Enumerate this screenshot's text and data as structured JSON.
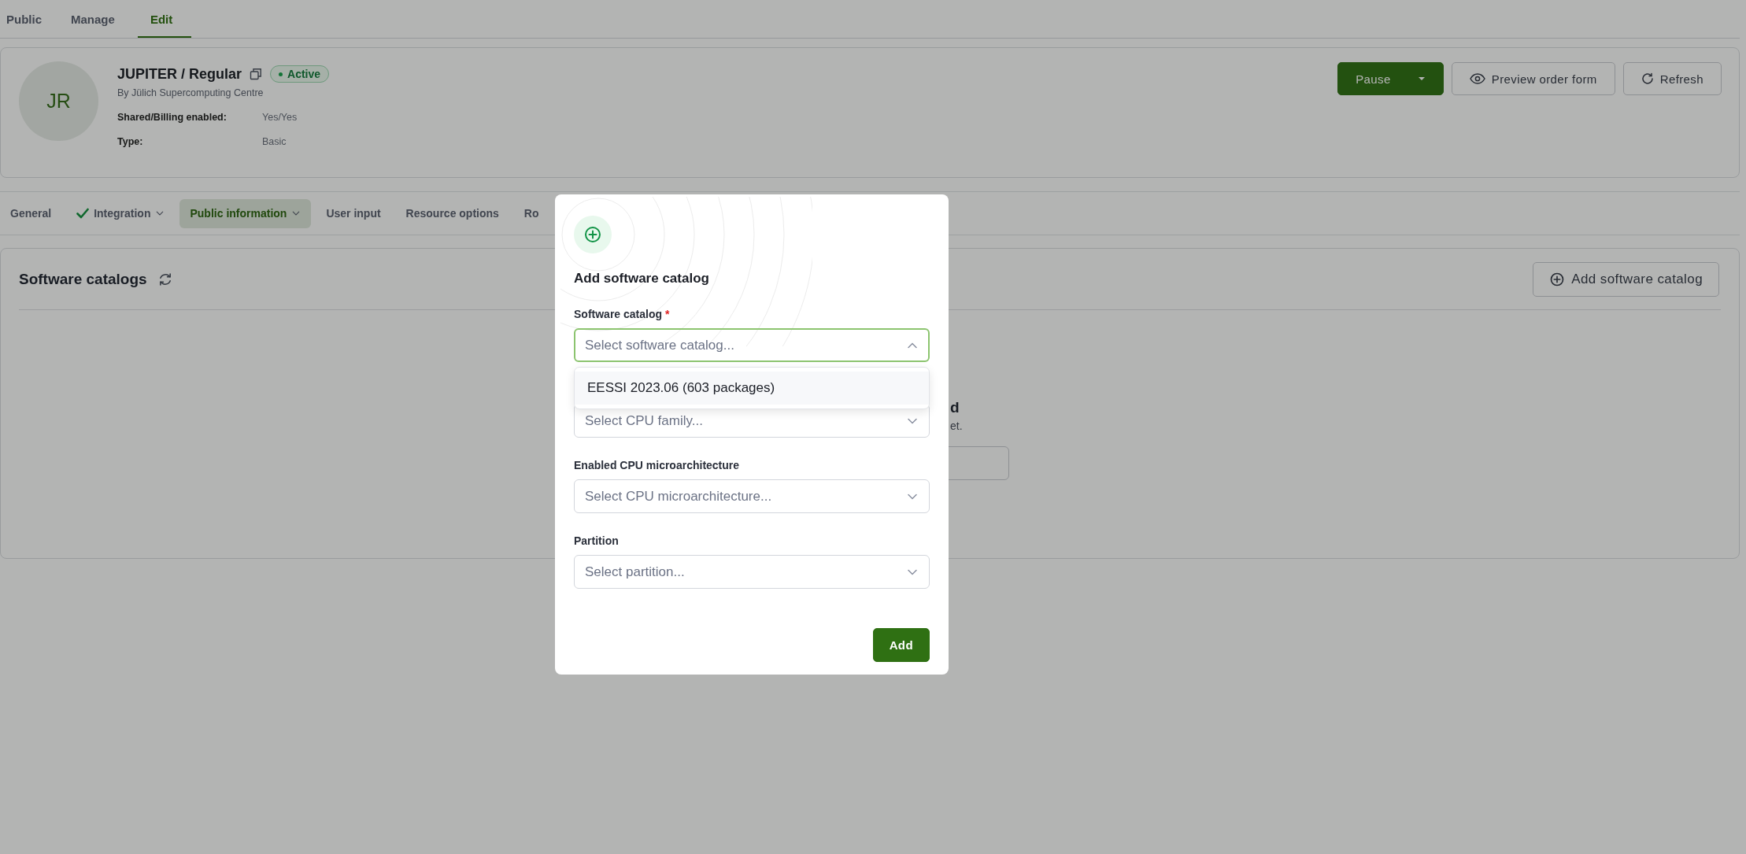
{
  "top_tabs": [
    {
      "label": "Public",
      "selected": false
    },
    {
      "label": "Manage",
      "selected": false
    },
    {
      "label": "Edit",
      "selected": true
    }
  ],
  "resource": {
    "initials": "JR",
    "title": "JUPITER / Regular",
    "status": "Active",
    "provider": "By Jülich Supercomputing Centre",
    "details": [
      {
        "label": "Shared/Billing enabled:",
        "value": "Yes/Yes"
      },
      {
        "label": "Type:",
        "value": "Basic"
      }
    ]
  },
  "actions": [
    {
      "kind": "split",
      "label": "Pause"
    },
    {
      "kind": "eye",
      "label": "Preview order form"
    },
    {
      "kind": "refresh",
      "label": "Refresh"
    }
  ],
  "section_tabs": [
    {
      "label": "General",
      "selected": false,
      "done": false,
      "menu": false
    },
    {
      "label": "Integration",
      "selected": false,
      "done": true,
      "menu": true
    },
    {
      "label": "Public information",
      "selected": true,
      "done": false,
      "menu": true
    },
    {
      "label": "User input",
      "selected": false,
      "done": false,
      "menu": false
    },
    {
      "label": "Resource options",
      "selected": false,
      "done": false,
      "menu": false
    },
    {
      "label": "Ro",
      "selected": false,
      "done": false,
      "menu": false
    }
  ],
  "section": {
    "title": "Software catalogs",
    "add_button": "Add software catalog",
    "empty_title": "d",
    "empty_text": "et."
  },
  "modal": {
    "title": "Add software catalog",
    "fields": [
      {
        "label": "Software catalog",
        "required": true,
        "placeholder": "Select software catalog...",
        "expanded": true,
        "options": [
          "EESSI 2023.06 (603 packages)"
        ]
      },
      {
        "placeholder": "Select CPU family...",
        "expanded": false
      },
      {
        "label": "Enabled CPU microarchitecture",
        "required": false,
        "placeholder": "Select CPU microarchitecture...",
        "expanded": false
      },
      {
        "label": "Partition",
        "required": false,
        "placeholder": "Select partition...",
        "expanded": false
      }
    ],
    "required_mark": "*",
    "submit": "Add"
  }
}
